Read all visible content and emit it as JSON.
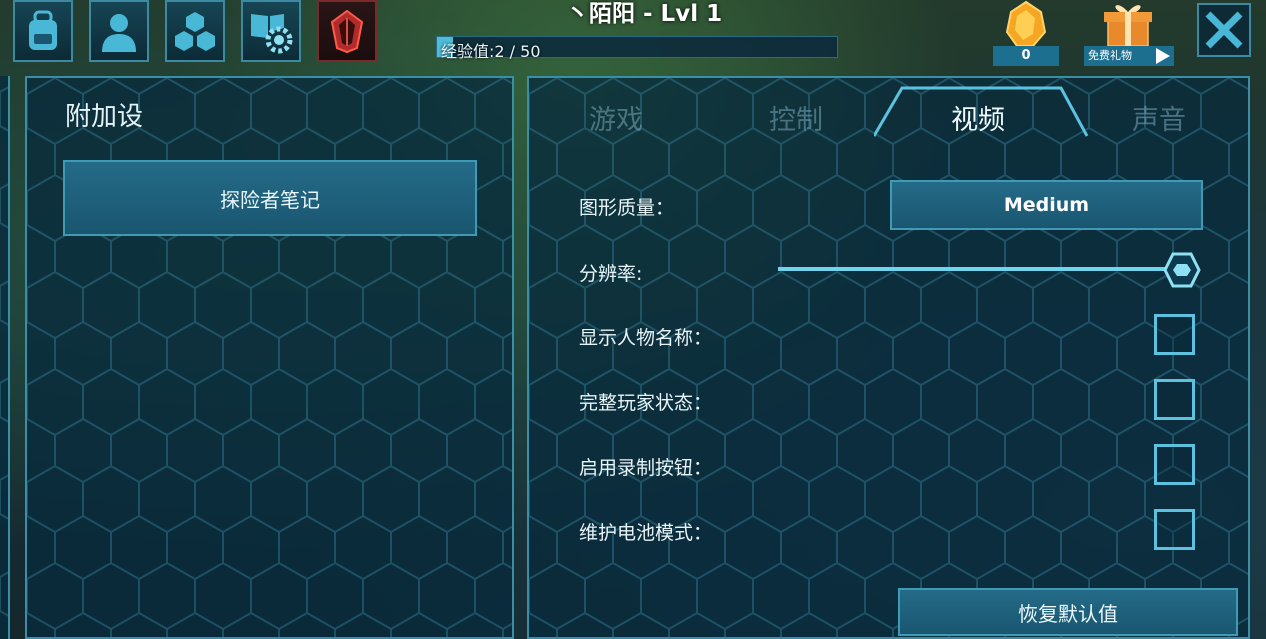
{
  "header": {
    "player_name": "丶陌阳 - Lvl 1",
    "xp_label": "经验值:2 / 50",
    "xp_progress": 0.04,
    "gem_count": "0",
    "gift_label": "免费礼物"
  },
  "top_icons": [
    "backpack-icon",
    "character-icon",
    "engrams-icon",
    "tribe-settings-icon",
    "specimen-implant-icon"
  ],
  "left_panel": {
    "title": "附加设",
    "notes_button": "探险者笔记"
  },
  "tabs": [
    {
      "label": "游戏",
      "active": false
    },
    {
      "label": "控制",
      "active": false
    },
    {
      "label": "视频",
      "active": true
    },
    {
      "label": "声音",
      "active": false
    }
  ],
  "settings": {
    "graphics_quality_label": "图形质量：",
    "graphics_quality_value": "Medium",
    "resolution_label": "分辨率:",
    "resolution_level": 1.0,
    "show_names_label": "显示人物名称：",
    "full_status_label": "完整玩家状态：",
    "record_button_label": "启用录制按钮：",
    "battery_mode_label": "维护电池模式：",
    "reset_button": "恢复默认值"
  },
  "colors": {
    "accent": "#3a8fa8",
    "button": "#1f6580",
    "slider": "#6fd4ec"
  }
}
